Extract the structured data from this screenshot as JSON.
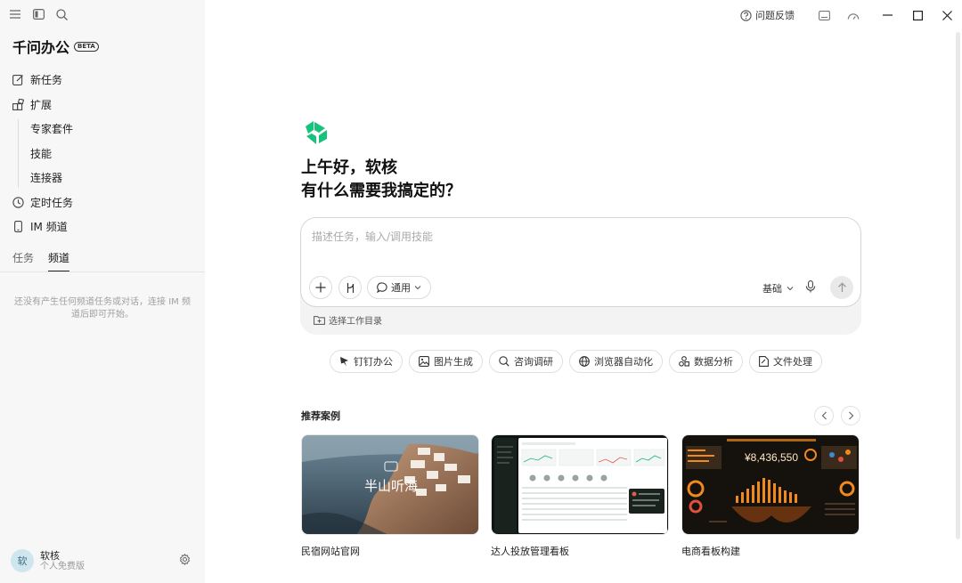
{
  "sidebar": {
    "brand_title": "千问办公",
    "beta_badge": "BETA",
    "nav": {
      "new_task": "新任务",
      "extend": "扩展",
      "expert_suite": "专家套件",
      "skills": "技能",
      "connectors": "连接器",
      "scheduled": "定时任务",
      "im_channel": "IM 频道"
    },
    "tabs": {
      "tasks": "任务",
      "channels": "频道"
    },
    "empty_note": "还没有产生任何频道任务或对话，连接 IM 频道后即可开始。",
    "user": {
      "avatar": "软",
      "name": "软核",
      "plan": "个人免费版"
    }
  },
  "titlebar": {
    "feedback": "问题反馈"
  },
  "main": {
    "greeting_line1": "上午好，软核",
    "greeting_line2": "有什么需要我搞定的？",
    "composer": {
      "placeholder": "描述任务，输入/调用技能",
      "mode": "通用",
      "model": "基础",
      "workdir": "选择工作目录"
    },
    "chips": [
      "钉钉办公",
      "图片生成",
      "咨询调研",
      "浏览器自动化",
      "数据分析",
      "文件处理"
    ],
    "recommend_title": "推荐案例",
    "cards": [
      {
        "label": "民宿网站官网",
        "overlay": "半山听海"
      },
      {
        "label": "达人投放管理看板"
      },
      {
        "label": "电商看板构建",
        "metric": "¥8,436,550"
      }
    ]
  },
  "colors": {
    "brand_green": "#17c37b",
    "accent_orange": "#f08a1c"
  }
}
